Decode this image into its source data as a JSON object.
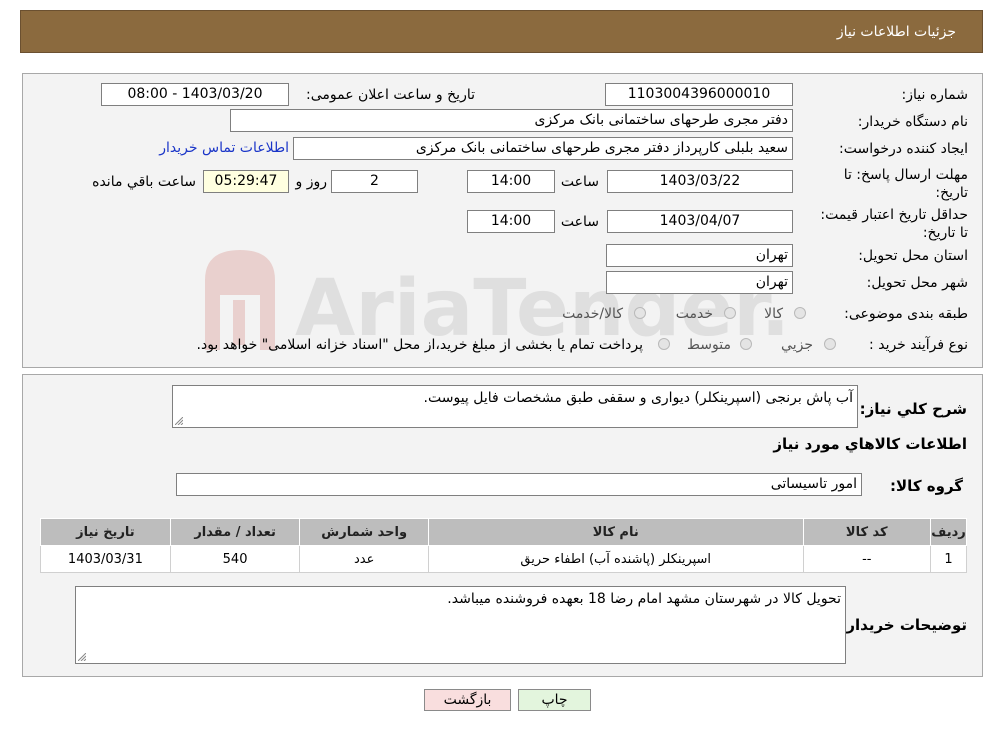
{
  "page": {
    "title": "جزئیات اطلاعات نیاز"
  },
  "need": {
    "number_label": "شماره نیاز:",
    "number_value": "1103004396000010",
    "announce_label": "تاریخ و ساعت اعلان عمومی:",
    "announce_value": "1403/03/20 - 08:00",
    "buyer_label": "نام دستگاه خریدار:",
    "buyer_value": "دفتر مجری طرحهای ساختمانی بانک مرکزی",
    "creator_label": "ایجاد کننده درخواست:",
    "creator_value": "سعید بلبلی کارپرداز دفتر مجری طرحهای ساختمانی بانک مرکزی",
    "contact_link": "اطلاعات تماس خریدار",
    "deadline_label": "مهلت ارسال پاسخ: تا تاریخ:",
    "deadline_date": "1403/03/22",
    "time_label": "ساعت",
    "deadline_time": "14:00",
    "days_value": "2",
    "days_label": "روز و",
    "remaining_value": "05:29:47",
    "remaining_label": "ساعت باقي مانده",
    "validity_label": "حداقل تاریخ اعتبار قیمت: تا تاریخ:",
    "validity_date": "1403/04/07",
    "validity_time": "14:00",
    "province_label": "استان محل تحویل:",
    "province_value": "تهران",
    "city_label": "شهر محل تحویل:",
    "city_value": "تهران",
    "category_label": "طبقه بندی موضوعی:",
    "category_options": [
      "کالا",
      "خدمت",
      "کالا/خدمت"
    ],
    "process_label": "نوع فرآیند خرید :",
    "process_options": [
      "جزیي",
      "متوسط"
    ],
    "process_note": "پرداخت تمام یا بخشی از مبلغ خرید،از محل \"اسناد خزانه اسلامی\" خواهد بود."
  },
  "details": {
    "desc_label": "شرح کلي نياز:",
    "desc_value": "آب پاش برنجی (اسپرینکلر) دیواری و سقفی طبق مشخصات فایل پیوست.",
    "goods_title": "اطلاعات کالاهاي مورد نياز",
    "group_label": "گروه کالا:",
    "group_value": "امور تاسیساتی",
    "table": {
      "headers": [
        "رديف",
        "کد کالا",
        "نام کالا",
        "واحد شمارش",
        "تعداد / مقدار",
        "تاريخ نياز"
      ],
      "rows": [
        [
          "1",
          "--",
          "اسپرینکلر (پاشنده آب) اطفاء حریق",
          "عدد",
          "540",
          "1403/03/31"
        ]
      ]
    },
    "buyer_notes_label": "توضيحات خريدار:",
    "buyer_notes_value": "تحویل کالا در شهرستان مشهد امام رضا 18 بعهده فروشنده میباشد."
  },
  "buttons": {
    "print": "چاپ",
    "back": "بازگشت"
  },
  "watermark": {
    "text": "AriaTender.neT"
  },
  "colors": {
    "header": "#8b6a3e",
    "link": "#1a35c8",
    "print_btn": "#e3f5dd",
    "back_btn": "#f9dede"
  }
}
